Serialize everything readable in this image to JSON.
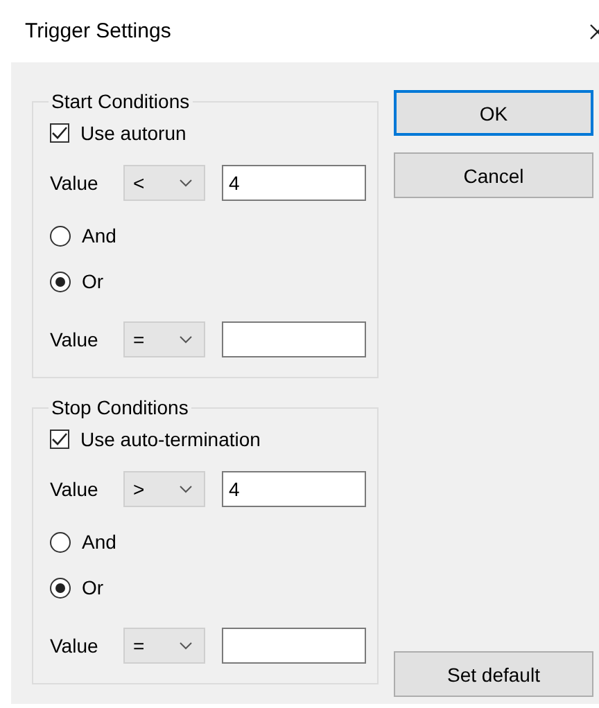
{
  "window": {
    "title": "Trigger Settings"
  },
  "groups": [
    {
      "title": "Start Conditions",
      "checkbox": {
        "label": "Use autorun",
        "checked": true
      },
      "condition": {
        "label": "Value",
        "operator": "<",
        "value": "4"
      },
      "radios": [
        {
          "label": "And",
          "selected": false
        },
        {
          "label": "Or",
          "selected": true
        }
      ],
      "extra_condition": {
        "label": "Value",
        "operator": "="
      }
    },
    {
      "title": "Stop Conditions",
      "checkbox": {
        "label": "Use auto-termination",
        "checked": true
      },
      "condition": {
        "label": "Value",
        "operator": ">",
        "value": "4"
      },
      "radios": [
        {
          "label": "And",
          "selected": false
        },
        {
          "label": "Or",
          "selected": true
        }
      ],
      "extra_condition": {
        "label": "Value",
        "operator": "="
      }
    }
  ],
  "buttons": [
    {
      "label": "OK",
      "kind": "top",
      "focused": true
    },
    {
      "label": "Cancel",
      "kind": "top",
      "focused": false
    },
    {
      "label": "Set default",
      "kind": "bottom",
      "focused": false
    }
  ]
}
